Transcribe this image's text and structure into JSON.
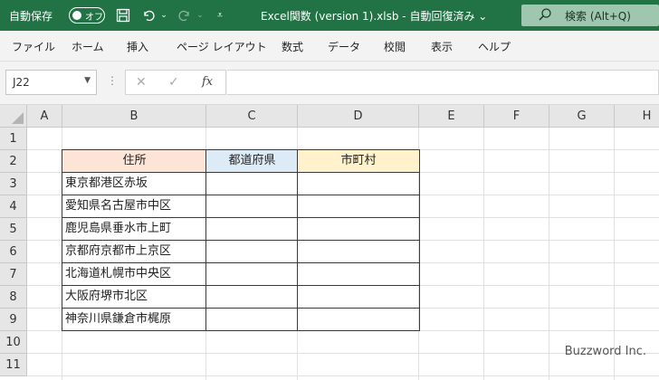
{
  "titlebar": {
    "autosave_label": "自動保存",
    "toggle_text": "オフ",
    "document_title": "Excel関数 (version 1).xlsb  -  自動回復済み  ⌄",
    "search_text": "検索 (Alt+Q)",
    "accent_color": "#217346"
  },
  "ribbon": {
    "tabs": [
      "ファイル",
      "ホーム",
      "挿入",
      "ページ レイアウト",
      "数式",
      "データ",
      "校閲",
      "表示",
      "ヘルプ"
    ]
  },
  "formula_bar": {
    "name_box": "J22",
    "fx_label": "fx",
    "formula_value": ""
  },
  "sheet": {
    "columns": [
      "A",
      "B",
      "C",
      "D",
      "E",
      "F",
      "G",
      "H"
    ],
    "rows": [
      "1",
      "2",
      "3",
      "4",
      "5",
      "6",
      "7",
      "8",
      "9",
      "10",
      "11"
    ],
    "headers": {
      "address": "住所",
      "prefecture": "都道府県",
      "city": "市町村"
    },
    "header_colors": {
      "address": "#fce4d6",
      "prefecture": "#ddebf7",
      "city": "#fff2cc"
    },
    "addresses": [
      "東京都港区赤坂",
      "愛知県名古屋市中区",
      "鹿児島県垂水市上町",
      "京都府京都市上京区",
      "北海道札幌市中央区",
      "大阪府堺市北区",
      "神奈川県鎌倉市梶原"
    ]
  },
  "watermark": "Buzzword Inc."
}
